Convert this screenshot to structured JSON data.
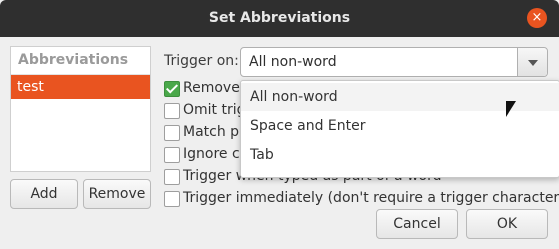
{
  "window": {
    "title": "Set Abbreviations",
    "close_icon": "×"
  },
  "list": {
    "header": "Abbreviations",
    "items": [
      "test"
    ],
    "add_label": "Add",
    "remove_label": "Remove"
  },
  "trigger": {
    "label": "Trigger on:",
    "selected": "All non-word",
    "options": [
      "All non-word",
      "Space and Enter",
      "Tab"
    ]
  },
  "options": [
    {
      "label": "Remove",
      "checked": true
    },
    {
      "label": "Omit trig",
      "checked": false
    },
    {
      "label": "Match pl",
      "checked": false
    },
    {
      "label": "Ignore ca",
      "checked": false
    },
    {
      "label": "Trigger when typed as part of a word",
      "checked": false
    },
    {
      "label": "Trigger immediately (don't require a trigger character)",
      "checked": false
    }
  ],
  "buttons": {
    "cancel": "Cancel",
    "ok": "OK"
  },
  "colors": {
    "accent": "#e95420",
    "checkbox_checked": "#4aa84a"
  }
}
